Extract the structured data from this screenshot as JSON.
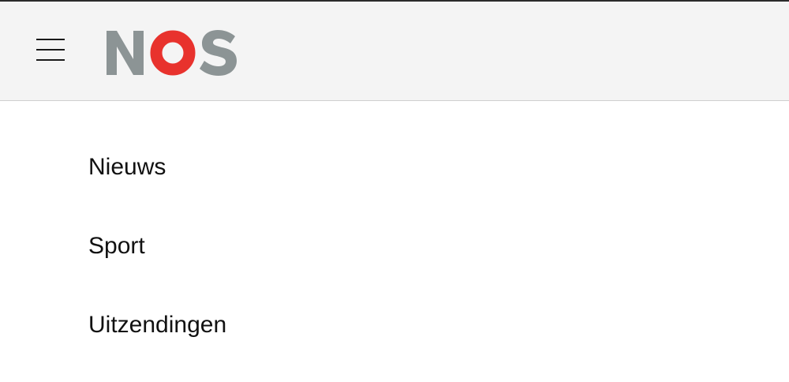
{
  "header": {
    "logo_text": "NOS",
    "logo_colors": {
      "letters": "#8c9495",
      "ring": "#e8322d"
    },
    "menu_icon": "hamburger-menu-icon"
  },
  "nav": {
    "items": [
      {
        "label": "Nieuws"
      },
      {
        "label": "Sport"
      },
      {
        "label": "Uitzendingen"
      }
    ]
  }
}
